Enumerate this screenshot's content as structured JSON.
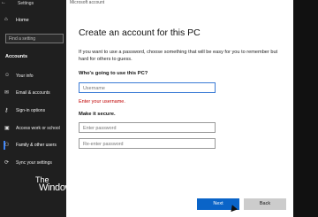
{
  "settings": {
    "title": "Settings",
    "home_label": "Home",
    "find_placeholder": "Find a setting",
    "section_label": "Accounts",
    "nav_items": [
      {
        "label": "Your info",
        "icon": "user-icon"
      },
      {
        "label": "Email & accounts",
        "icon": "email-icon"
      },
      {
        "label": "Sign-in options",
        "icon": "key-icon"
      },
      {
        "label": "Access work or school",
        "icon": "briefcase-icon"
      },
      {
        "label": "Family & other users",
        "icon": "family-icon"
      },
      {
        "label": "Sync your settings",
        "icon": "sync-icon"
      }
    ],
    "active_index": 4
  },
  "watermark": {
    "line1": "The",
    "line2": "WindowsClub"
  },
  "dialog": {
    "window_title": "Microsoft account",
    "heading": "Create an account for this PC",
    "description": "If you want to use a password, choose something that will be easy for you to remember but hard for others to guess.",
    "username_question": "Who's going to use this PC?",
    "username_placeholder": "Username",
    "username_error": "Enter your username.",
    "secure_heading": "Make it secure.",
    "password_placeholder": "Enter password",
    "reenter_placeholder": "Re-enter password",
    "next_label": "Next",
    "back_label": "Back"
  },
  "colors": {
    "accent": "#0a64c8",
    "error": "#c00000",
    "sidebar_bg": "#1f1f1f"
  }
}
